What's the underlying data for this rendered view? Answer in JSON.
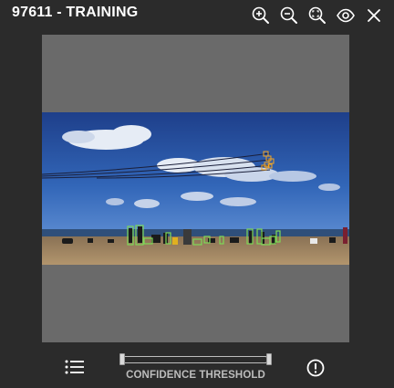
{
  "header": {
    "title": "97611 - TRAINING",
    "tools": [
      {
        "icon": "zoom-in-icon"
      },
      {
        "icon": "zoom-out-icon"
      },
      {
        "icon": "zoom-fit-icon"
      },
      {
        "icon": "eye-icon"
      },
      {
        "icon": "close-icon"
      }
    ]
  },
  "viewer": {
    "image_description": "beach scene",
    "box_colors": {
      "people": "#7ed957",
      "birds": "#f5a623"
    }
  },
  "footer": {
    "list_icon": "list-icon",
    "slider_label": "CONFIDENCE THRESHOLD",
    "slider_range": {
      "min": 0,
      "max": 1
    },
    "alert_icon": "alert-circle-icon"
  },
  "colors": {
    "background": "#2b2b2b",
    "viewer_bg": "#6a6a6a",
    "label": "#bdbdbd"
  }
}
